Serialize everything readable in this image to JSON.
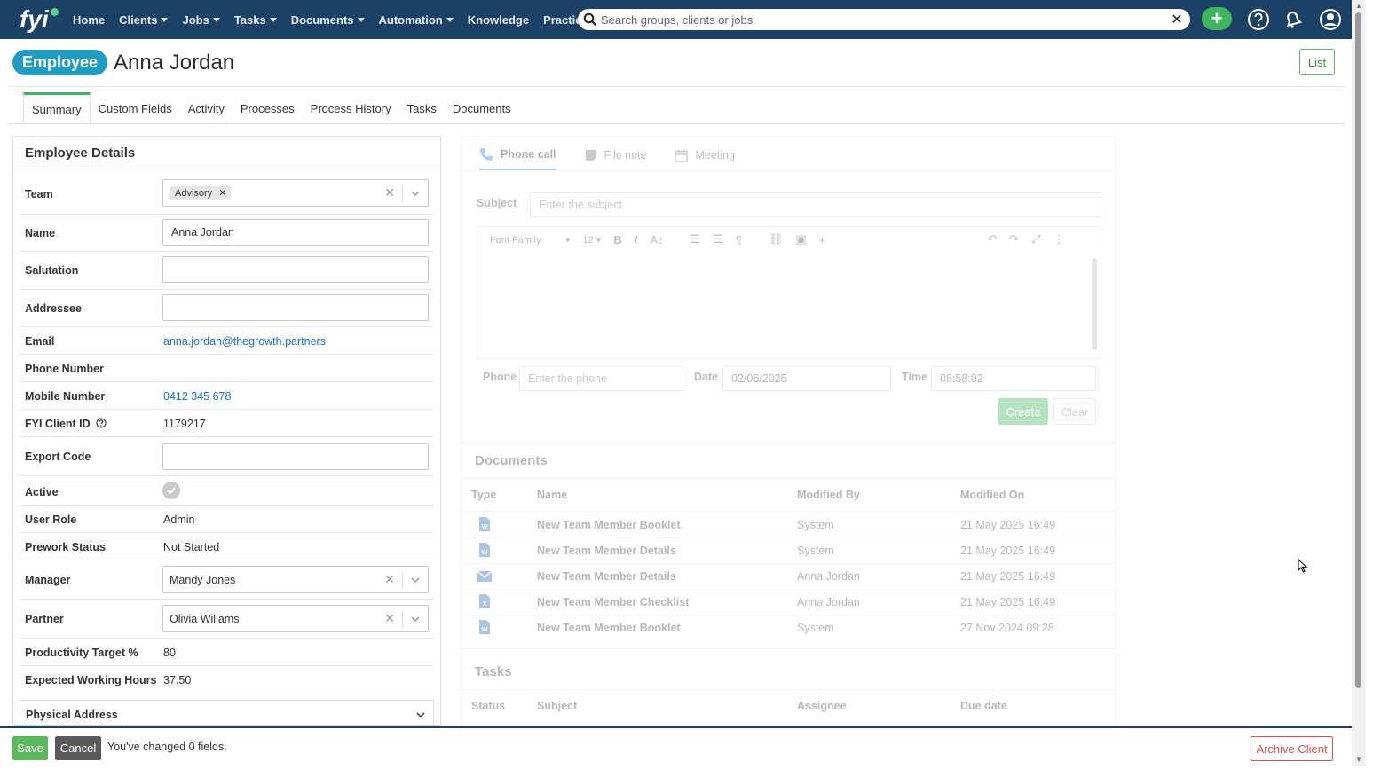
{
  "nav": {
    "logo": "fyi",
    "items": [
      {
        "label": "Home",
        "dropdown": false
      },
      {
        "label": "Clients",
        "dropdown": true
      },
      {
        "label": "Jobs",
        "dropdown": true
      },
      {
        "label": "Tasks",
        "dropdown": true
      },
      {
        "label": "Documents",
        "dropdown": true
      },
      {
        "label": "Automation",
        "dropdown": true
      },
      {
        "label": "Knowledge",
        "dropdown": false
      },
      {
        "label": "Practice",
        "dropdown": false
      }
    ],
    "search_placeholder": "Search groups, clients or jobs",
    "icons": [
      "plus-icon",
      "help-icon",
      "bell-icon",
      "user-icon"
    ],
    "bar_color": "#1c4167",
    "accent_color": "#3fb55f"
  },
  "header": {
    "badge": "Employee",
    "title": "Anna Jordan",
    "list_button": "List",
    "badge_color": "#1f9cc1"
  },
  "tabs": [
    "Summary",
    "Custom Fields",
    "Activity",
    "Processes",
    "Process History",
    "Tasks",
    "Documents"
  ],
  "active_tab": "Summary",
  "details": {
    "title": "Employee Details",
    "team_label": "Team",
    "team_chip": "Advisory",
    "name_label": "Name",
    "name_value": "Anna Jordan",
    "salutation_label": "Salutation",
    "salutation_value": "",
    "addressee_label": "Addressee",
    "addressee_value": "",
    "email_label": "Email",
    "email_value": "anna.jordan@thegrowth.partners",
    "phone_label": "Phone Number",
    "phone_value": "",
    "mobile_label": "Mobile Number",
    "mobile_value": "0412 345 678",
    "client_id_label": "FYI Client ID",
    "client_id_value": "1179217",
    "export_code_label": "Export Code",
    "export_code_value": "",
    "active_label": "Active",
    "user_role_label": "User Role",
    "user_role_value": "Admin",
    "prework_label": "Prework Status",
    "prework_value": "Not Started",
    "manager_label": "Manager",
    "manager_value": "Mandy Jones",
    "partner_label": "Partner",
    "partner_value": "Olivia Wiliams",
    "productivity_label": "Productivity Target %",
    "productivity_value": "80",
    "hours_label": "Expected Working Hours",
    "hours_value": "37.50",
    "address_label": "Physical Address"
  },
  "note": {
    "tabs": [
      "Phone call",
      "File note",
      "Meeting"
    ],
    "subject_label": "Subject",
    "subject_placeholder": "Enter the subject",
    "font_family": "Font Family",
    "font_size": "12",
    "phone_label": "Phone",
    "phone_placeholder": "Enter the phone",
    "date_label": "Date",
    "date_value": "02/06/2025",
    "time_label": "Time",
    "time_value": "08:58:02",
    "create_button": "Create",
    "clear_button": "Clear"
  },
  "documents": {
    "title": "Documents",
    "columns": [
      "Type",
      "Name",
      "Modified By",
      "Modified On"
    ],
    "rows": [
      {
        "type": "word-doc-icon",
        "name": "New Team Member Booklet",
        "modified_by": "System",
        "modified_on": "21 May 2025 16:49"
      },
      {
        "type": "word-doc-icon",
        "name": "New Team Member Details",
        "modified_by": "System",
        "modified_on": "21 May 2025 16:49"
      },
      {
        "type": "email-icon",
        "name": "New Team Member Details",
        "modified_by": "Anna Jordan",
        "modified_on": "21 May 2025 16:49"
      },
      {
        "type": "excel-doc-icon",
        "name": "New Team Member Checklist",
        "modified_by": "Anna Jordan",
        "modified_on": "21 May 2025 16:49"
      },
      {
        "type": "word-doc-icon",
        "name": "New Team Member Booklet",
        "modified_by": "System",
        "modified_on": "27 Nov 2024 09:28"
      }
    ]
  },
  "tasks": {
    "title": "Tasks",
    "columns": [
      "Status",
      "Subject",
      "Assignee",
      "Due date"
    ]
  },
  "bottom": {
    "save": "Save",
    "cancel": "Cancel",
    "changed_text": "You've changed 0 fields.",
    "archive": "Archive Client"
  }
}
